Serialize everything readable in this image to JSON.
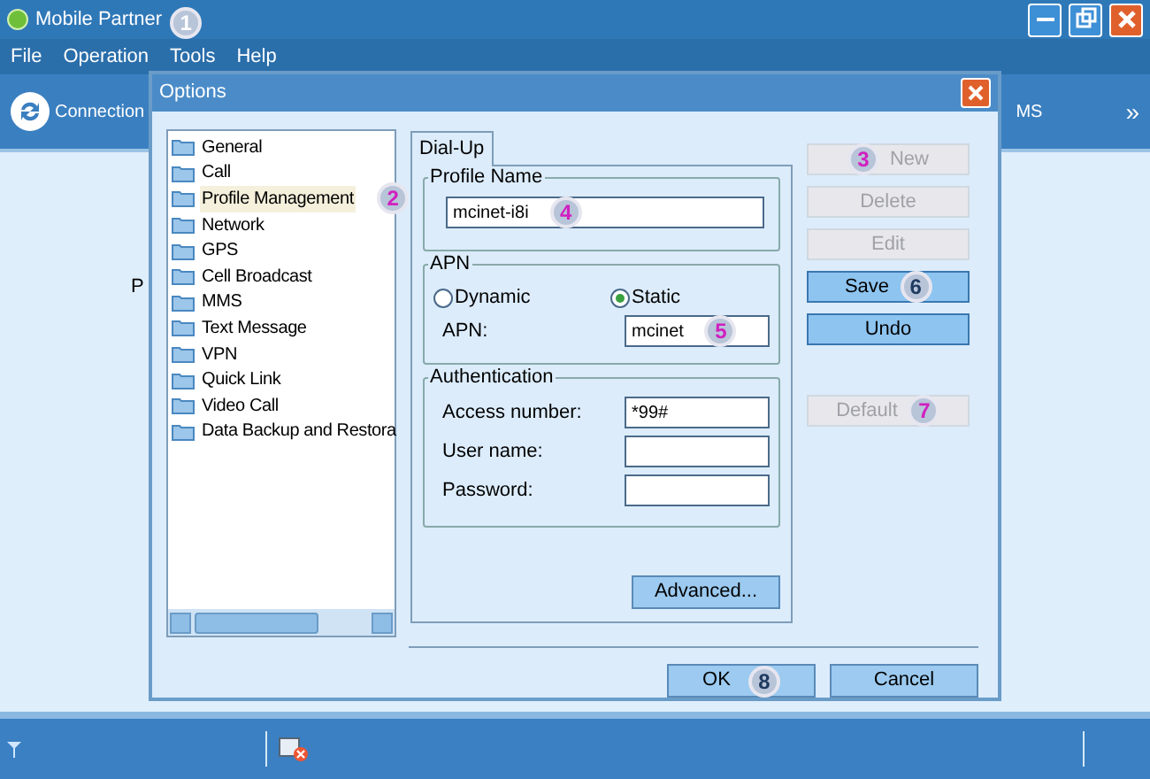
{
  "window": {
    "title": "Mobile Partner"
  },
  "menu": [
    {
      "label": "File"
    },
    {
      "label": "Operation"
    },
    {
      "label": "Tools",
      "callout": {
        "text": "1",
        "color": "#ffffff"
      }
    },
    {
      "label": "Help"
    }
  ],
  "toolbar": {
    "items": [
      {
        "label": "Connection"
      },
      {
        "label": "MS"
      }
    ],
    "more": "»"
  },
  "content": {
    "text": "P"
  },
  "dialog": {
    "title": "Options",
    "tree": [
      {
        "label": "General",
        "selected": false
      },
      {
        "label": "Call",
        "selected": false
      },
      {
        "label": "Profile Management",
        "selected": true,
        "callout": {
          "text": "2",
          "color": "#d020c0"
        }
      },
      {
        "label": "Network",
        "selected": false
      },
      {
        "label": "GPS",
        "selected": false
      },
      {
        "label": "Cell Broadcast",
        "selected": false
      },
      {
        "label": "MMS",
        "selected": false
      },
      {
        "label": "Text Message",
        "selected": false
      },
      {
        "label": "VPN",
        "selected": false
      },
      {
        "label": "Quick Link",
        "selected": false
      },
      {
        "label": "Video Call",
        "selected": false
      },
      {
        "label": "Data Backup and Restora",
        "selected": false
      }
    ],
    "tabs": [
      {
        "label": "Dial-Up",
        "selected": true
      }
    ],
    "profile_name": {
      "legend": "Profile Name",
      "value": "mcinet-i8i",
      "callout": {
        "text": "4",
        "color": "#d020c0"
      }
    },
    "apn": {
      "legend": "APN",
      "options": [
        {
          "label": "Dynamic",
          "selected": false
        },
        {
          "label": "Static",
          "selected": true
        }
      ],
      "label": "APN:",
      "value": "mcinet",
      "callout": {
        "text": "5",
        "color": "#d020c0"
      }
    },
    "authentication": {
      "legend": "Authentication",
      "fields": [
        {
          "label": "Access number:",
          "value": "*99#"
        },
        {
          "label": "User name:"
        },
        {
          "label": "Password:"
        }
      ]
    },
    "advanced_button": "Advanced...",
    "side_buttons": [
      {
        "label": "New",
        "disabled": true,
        "callout": {
          "text": "3",
          "color": "#d020c0"
        }
      },
      {
        "label": "Delete",
        "disabled": true
      },
      {
        "label": "Edit",
        "disabled": true
      },
      {
        "label": "Save",
        "disabled": false,
        "callout": {
          "text": "6",
          "color": "#1e3a5f"
        }
      },
      {
        "label": "Undo",
        "disabled": false
      },
      {
        "label": "Default",
        "disabled": true,
        "callout": {
          "text": "7",
          "color": "#d020c0"
        }
      }
    ],
    "footer_buttons": [
      {
        "label": "OK",
        "callout": {
          "text": "8",
          "color": "#1e3a5f"
        }
      },
      {
        "label": "Cancel"
      }
    ]
  }
}
